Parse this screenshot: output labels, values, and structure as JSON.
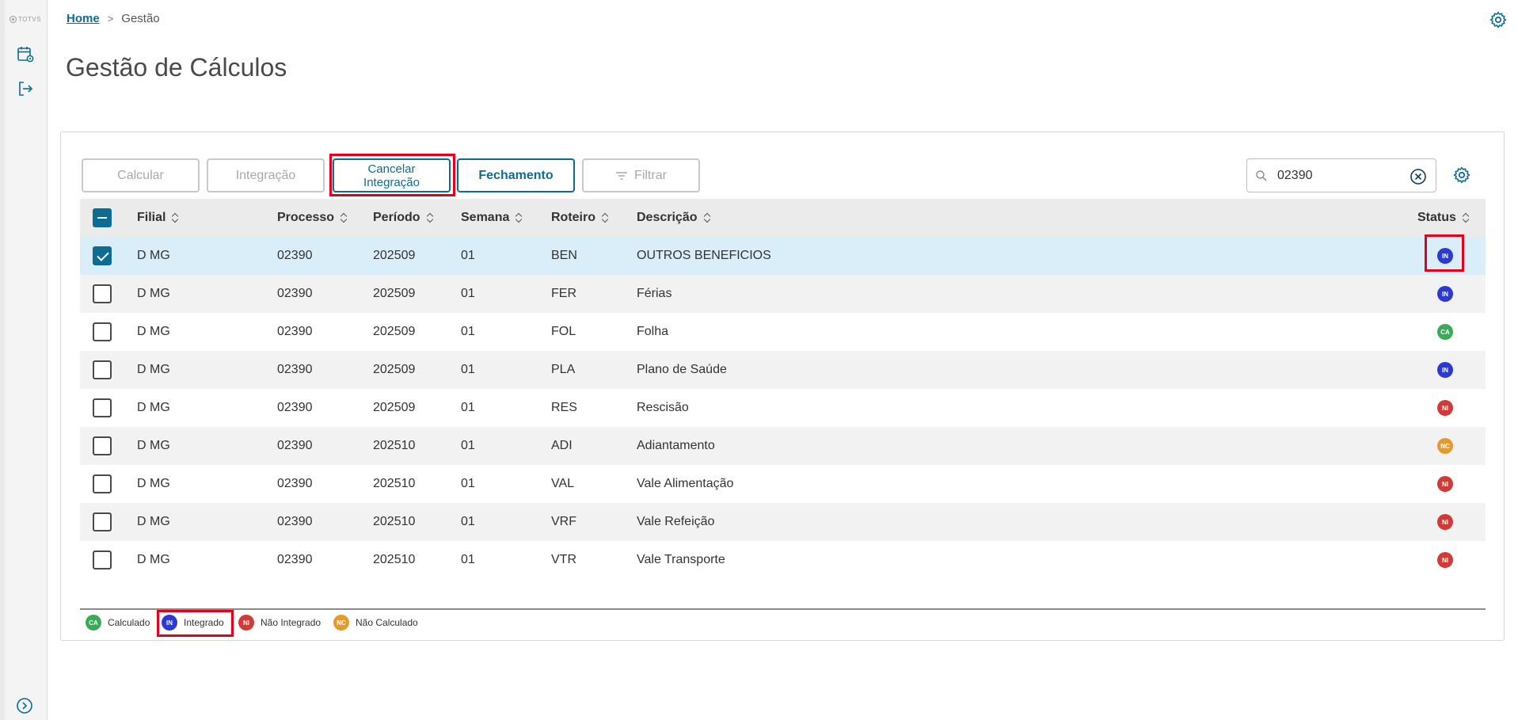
{
  "sidebar": {
    "logo_text": "TOTVS",
    "icons": [
      "calendar-settings-icon",
      "logout-icon"
    ],
    "expand_icon": "chevron-right-circle-icon"
  },
  "breadcrumb": {
    "home": "Home",
    "separator": ">",
    "current": "Gestão"
  },
  "page": {
    "title": "Gestão de Cálculos"
  },
  "toolbar": {
    "calcular": "Calcular",
    "integracao": "Integração",
    "cancelar_line1": "Cancelar",
    "cancelar_line2": "Integração",
    "fechamento": "Fechamento",
    "filtrar": "Filtrar"
  },
  "search": {
    "value": "02390"
  },
  "table": {
    "columns": [
      "Filial",
      "Processo",
      "Período",
      "Semana",
      "Roteiro",
      "Descrição",
      "Status"
    ],
    "rows": [
      {
        "filial": "D MG",
        "processo": "02390",
        "periodo": "202509",
        "semana": "01",
        "roteiro": "BEN",
        "descricao": "OUTROS BENEFICIOS",
        "status": "IN",
        "checked": true
      },
      {
        "filial": "D MG",
        "processo": "02390",
        "periodo": "202509",
        "semana": "01",
        "roteiro": "FER",
        "descricao": "Férias",
        "status": "IN",
        "checked": false
      },
      {
        "filial": "D MG",
        "processo": "02390",
        "periodo": "202509",
        "semana": "01",
        "roteiro": "FOL",
        "descricao": "Folha",
        "status": "CA",
        "checked": false
      },
      {
        "filial": "D MG",
        "processo": "02390",
        "periodo": "202509",
        "semana": "01",
        "roteiro": "PLA",
        "descricao": "Plano de Saúde",
        "status": "IN",
        "checked": false
      },
      {
        "filial": "D MG",
        "processo": "02390",
        "periodo": "202509",
        "semana": "01",
        "roteiro": "RES",
        "descricao": "Rescisão",
        "status": "NI",
        "checked": false
      },
      {
        "filial": "D MG",
        "processo": "02390",
        "periodo": "202510",
        "semana": "01",
        "roteiro": "ADI",
        "descricao": "Adiantamento",
        "status": "NC",
        "checked": false
      },
      {
        "filial": "D MG",
        "processo": "02390",
        "periodo": "202510",
        "semana": "01",
        "roteiro": "VAL",
        "descricao": "Vale Alimentação",
        "status": "NI",
        "checked": false
      },
      {
        "filial": "D MG",
        "processo": "02390",
        "periodo": "202510",
        "semana": "01",
        "roteiro": "VRF",
        "descricao": "Vale Refeição",
        "status": "NI",
        "checked": false
      },
      {
        "filial": "D MG",
        "processo": "02390",
        "periodo": "202510",
        "semana": "01",
        "roteiro": "VTR",
        "descricao": "Vale Transporte",
        "status": "NI",
        "checked": false
      }
    ]
  },
  "legend": [
    {
      "code": "CA",
      "label": "Calculado"
    },
    {
      "code": "IN",
      "label": "Integrado"
    },
    {
      "code": "NI",
      "label": "Não Integrado"
    },
    {
      "code": "NC",
      "label": "Não Calculado"
    }
  ],
  "colors": {
    "primary": "#0c6c94",
    "highlight": "#e3001b",
    "status_IN": "#2b3bd1",
    "status_CA": "#3aaa57",
    "status_NI": "#cf3b36",
    "status_NC": "#e59a2e",
    "row_selected": "#d9eef8"
  }
}
